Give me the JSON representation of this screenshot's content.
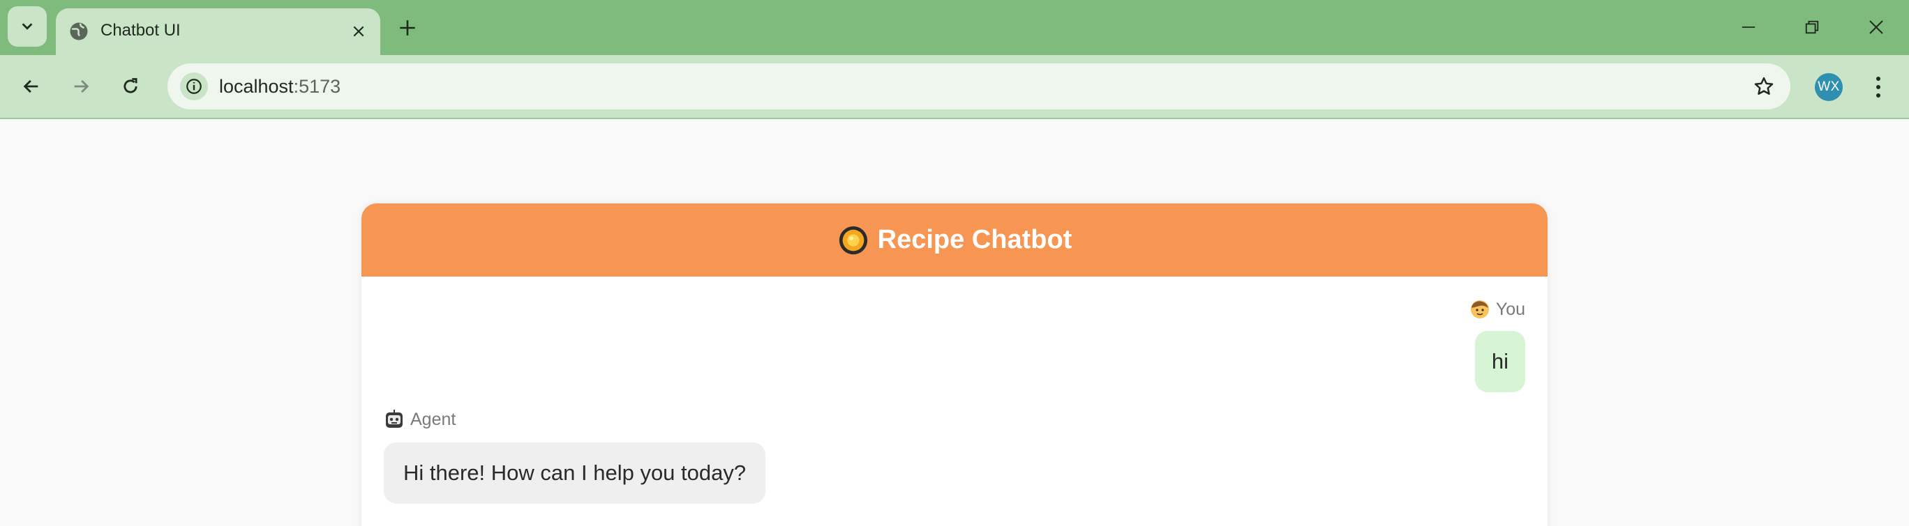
{
  "browser": {
    "tab_title": "Chatbot UI",
    "url_host": "localhost",
    "url_port": ":5173",
    "profile_initials": "WX",
    "theme_color": "#7fbb7d"
  },
  "chat": {
    "title": "Recipe Chatbot",
    "header_icon": "cooking-pan-icon",
    "accent_color": "#f79653",
    "messages": [
      {
        "sender": "You",
        "text": "hi",
        "role": "user",
        "icon": "person-icon"
      },
      {
        "sender": "Agent",
        "text": "Hi there! How can I help you today?",
        "role": "agent",
        "icon": "robot-icon"
      }
    ]
  }
}
